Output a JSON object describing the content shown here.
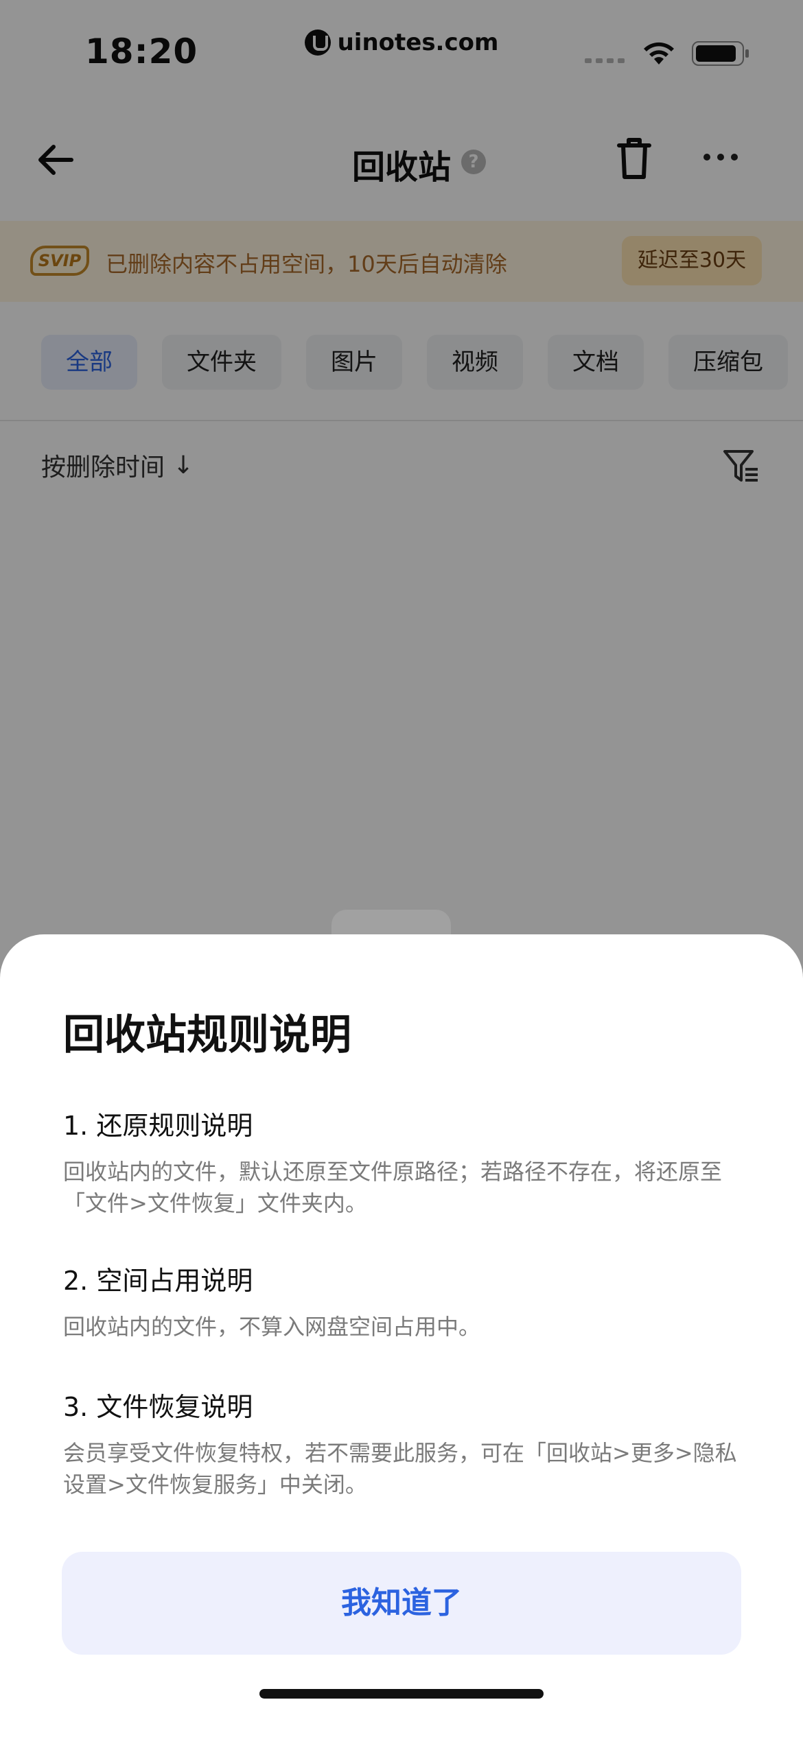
{
  "status_bar": {
    "time": "18:20",
    "watermark": "uinotes.com"
  },
  "nav": {
    "title": "回收站",
    "help": "?"
  },
  "vip": {
    "badge": "SVIP",
    "text": "已删除内容不占用空间，10天后自动清除",
    "extend": "延迟至30天"
  },
  "tabs": [
    {
      "label": "全部",
      "active": true
    },
    {
      "label": "文件夹"
    },
    {
      "label": "图片"
    },
    {
      "label": "视频"
    },
    {
      "label": "文档"
    },
    {
      "label": "压缩包"
    }
  ],
  "sort": {
    "label": "按删除时间",
    "arrow": "↓"
  },
  "sheet": {
    "title": "回收站规则说明",
    "rules": [
      {
        "heading": "1. 还原规则说明",
        "body": "回收站内的文件，默认还原至文件原路径；若路径不存在，将还原至「文件>文件恢复」文件夹内。"
      },
      {
        "heading": "2. 空间占用说明",
        "body": "回收站内的文件，不算入网盘空间占用中。"
      },
      {
        "heading": "3. 文件恢复说明",
        "body": "会员享受文件恢复特权，若不需要此服务，可在「回收站>更多>隐私设置>文件恢复服务」中关闭。"
      }
    ],
    "ok_button": "我知道了"
  },
  "colors": {
    "accent": "#2c63e0",
    "vip_text": "#a9692a",
    "vip_bg": "#fff5e0"
  }
}
